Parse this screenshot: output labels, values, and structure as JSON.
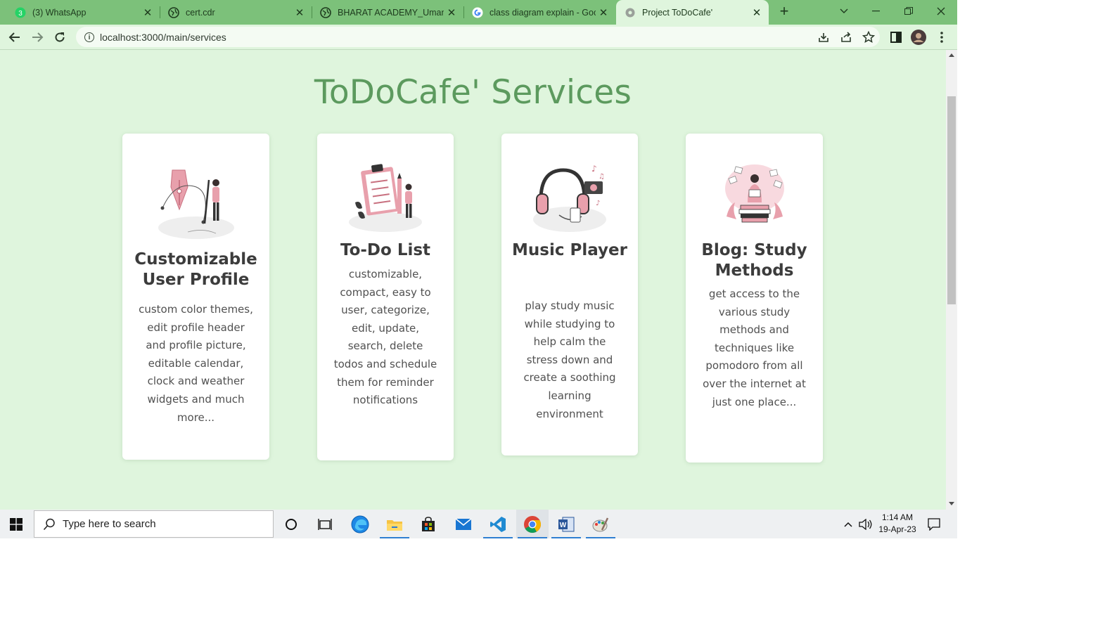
{
  "browser": {
    "tabs": [
      {
        "title": "(3) WhatsApp",
        "icon": "whatsapp-icon",
        "active": false
      },
      {
        "title": "cert.cdr",
        "icon": "globe-icon",
        "active": false
      },
      {
        "title": "BHARAT ACADEMY_Umang S",
        "icon": "globe-icon",
        "active": false
      },
      {
        "title": "class diagram explain - Goog",
        "icon": "google-icon",
        "active": false
      },
      {
        "title": "Project ToDoCafe'",
        "icon": "todocafe-icon",
        "active": true
      }
    ],
    "url": "localhost:3000/main/services",
    "colors": {
      "frame": "#7cc17a",
      "toolbar": "#dff5dd"
    }
  },
  "page": {
    "title": "ToDoCafe' Services",
    "background": "#dff5dd",
    "title_color": "#5c9a5e",
    "cards": [
      {
        "title": "Customizable User Profile",
        "description": "custom color themes, edit profile header and profile picture, editable calendar, clock and weather widgets and much more...",
        "illustration": "pen-tool-designer-illustration"
      },
      {
        "title": "To-Do List",
        "description": "customizable, compact, easy to user, categorize, edit, update, search, delete todos and schedule them for reminder notifications",
        "illustration": "clipboard-checklist-illustration"
      },
      {
        "title": "Music Player",
        "description": "play study music while studying to help calm the stress down and create a soothing learning environment",
        "illustration": "headphones-music-illustration"
      },
      {
        "title": "Blog: Study Methods",
        "description": "get access to the various study methods and techniques like pomodoro from all over the internet at just one place...",
        "illustration": "reading-books-illustration"
      }
    ]
  },
  "taskbar": {
    "search_placeholder": "Type here to search",
    "time": "1:14 AM",
    "date": "19-Apr-23",
    "apps": [
      "cortana-icon",
      "task-view-icon",
      "edge-icon",
      "file-explorer-icon",
      "store-icon",
      "mail-icon",
      "vscode-icon",
      "chrome-icon",
      "word-icon",
      "paint-icon"
    ]
  }
}
